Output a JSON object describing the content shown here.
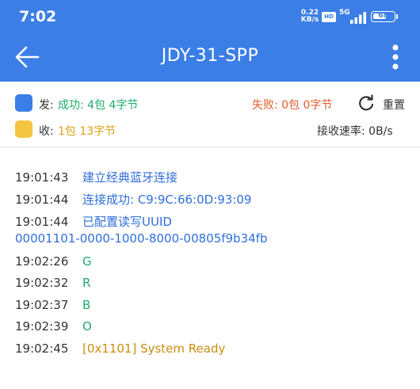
{
  "status_bar": {
    "time": "7:02",
    "net_speed_value": "0.22",
    "net_speed_unit": "KB/s",
    "hd_badge": "HD",
    "network_type": "5G",
    "battery_level": 68
  },
  "app_bar": {
    "title": "JDY-31-SPP"
  },
  "stats": {
    "send": {
      "label": "发:",
      "success": "成功: 4包 4字节",
      "fail": "失败: 0包 0字节",
      "reset": "重置"
    },
    "recv": {
      "label": "收:",
      "value": "1包 13字节",
      "rate": "接收速率: 0B/s"
    }
  },
  "log": [
    {
      "time": "19:01:43",
      "msg": "建立经典蓝牙连接",
      "color": "#2f6fdb"
    },
    {
      "time": "19:01:44",
      "msg": "连接成功: C9:9C:66:0D:93:09",
      "color": "#2f6fdb"
    },
    {
      "time": "19:01:44",
      "msg": "已配置读写UUID",
      "cont": "00001101-0000-1000-8000-00805f9b34fb",
      "color": "#2f6fdb"
    },
    {
      "time": "19:02:26",
      "msg": "G",
      "color": "#1faa6a"
    },
    {
      "time": "19:02:32",
      "msg": "R",
      "color": "#1faa6a"
    },
    {
      "time": "19:02:37",
      "msg": "B",
      "color": "#1faa6a"
    },
    {
      "time": "19:02:39",
      "msg": "O",
      "color": "#1faa6a"
    },
    {
      "time": "19:02:45",
      "msg": "[0x1101] System Ready",
      "color": "#c88e10"
    }
  ],
  "colors": {
    "primary": "#3b7ee6",
    "success": "#1faa6a",
    "warning": "#f4c542",
    "error": "#e35b2a"
  }
}
